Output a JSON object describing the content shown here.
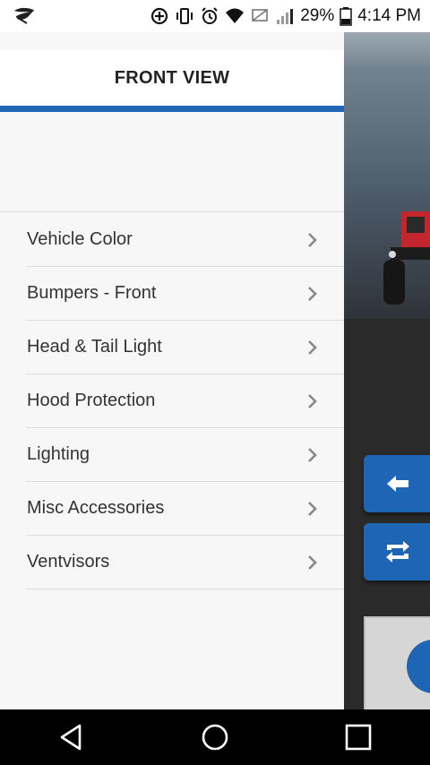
{
  "status_bar": {
    "battery_percent": "29%",
    "time": "4:14 PM",
    "icons": [
      "leaf-icon",
      "data-saver-icon",
      "vibrate-icon",
      "alarm-icon",
      "wifi-icon",
      "no-sim-icon",
      "signal-icon",
      "battery-icon"
    ]
  },
  "drawer": {
    "title": "FRONT VIEW",
    "accent_color": "#2166b4",
    "items": [
      {
        "label": "Vehicle Color"
      },
      {
        "label": "Bumpers - Front"
      },
      {
        "label": "Head & Tail Light"
      },
      {
        "label": "Hood Protection"
      },
      {
        "label": "Lighting"
      },
      {
        "label": "Misc Accessories"
      },
      {
        "label": "Ventvisors"
      }
    ]
  },
  "background_app": {
    "button_color": "#1f65b5",
    "buttons": [
      "back-arrow-icon",
      "swap-icon"
    ]
  },
  "nav_bar": {
    "buttons": [
      "back-icon",
      "home-icon",
      "recents-icon"
    ]
  }
}
